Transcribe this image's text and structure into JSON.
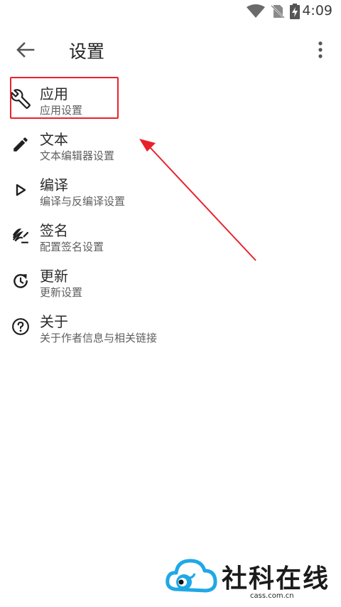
{
  "status_bar": {
    "time": "4:09",
    "icons": [
      "wifi-icon",
      "no-sim-icon",
      "battery-charging-icon"
    ]
  },
  "toolbar": {
    "back_icon": "arrow-left-icon",
    "title": "设置",
    "overflow_icon": "more-vertical-icon"
  },
  "settings": {
    "items": [
      {
        "icon": "wrench-icon",
        "title": "应用",
        "subtitle": "应用设置"
      },
      {
        "icon": "pencil-icon",
        "title": "文本",
        "subtitle": "文本编辑器设置"
      },
      {
        "icon": "play-outline-icon",
        "title": "编译",
        "subtitle": "编译与反编译设置"
      },
      {
        "icon": "signature-icon",
        "title": "签名",
        "subtitle": "配置签名设置"
      },
      {
        "icon": "update-icon",
        "title": "更新",
        "subtitle": "更新设置"
      },
      {
        "icon": "help-circle-icon",
        "title": "关于",
        "subtitle": "关于作者信息与相关链接"
      }
    ]
  },
  "annotation": {
    "highlight_color": "#e8212a",
    "arrow_color": "#e8212a"
  },
  "watermark": {
    "text": "社科在线",
    "domain": "cass.com.cn",
    "logo_color": "#1fa8e6"
  },
  "colors": {
    "background": "#ffffff",
    "title_text": "#212121",
    "subtitle_text": "#5f5f5f",
    "icon": "#1f1f1f"
  }
}
